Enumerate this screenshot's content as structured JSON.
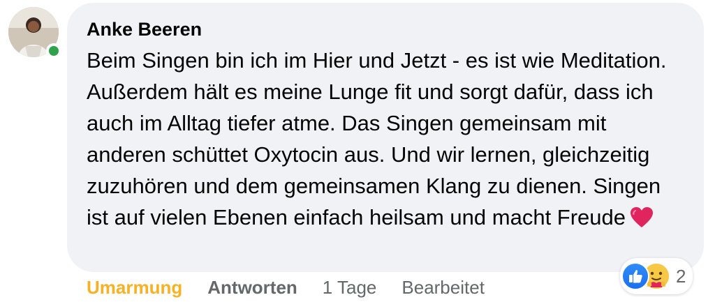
{
  "comment": {
    "author": "Anke Beeren",
    "text": "Beim Singen bin ich im Hier und Jetzt - es ist wie Meditation. Außerdem hält es meine Lunge fit und sorgt dafür, dass ich auch im Alltag tiefer atme. Das Singen gemeinsam mit anderen schüttet Oxytocin aus. Und wir lernen, gleichzeitig zuzuhören und dem gemeinsamen Klang zu dienen. Singen ist auf vielen Ebenen einfach heilsam und macht Freude",
    "emoji_icon": "red-heart-icon",
    "online": true
  },
  "reactions": {
    "icons": [
      "like-icon",
      "care-icon"
    ],
    "count": "2"
  },
  "actions": {
    "hug_label": "Umarmung",
    "reply_label": "Antworten",
    "time": "1 Tage",
    "edited": "Bearbeitet"
  },
  "colors": {
    "bubble": "#f0f2f5",
    "hug": "#f7b125",
    "secondary_text": "#65676b",
    "online": "#31a24c",
    "like": "#1b6ff0"
  }
}
